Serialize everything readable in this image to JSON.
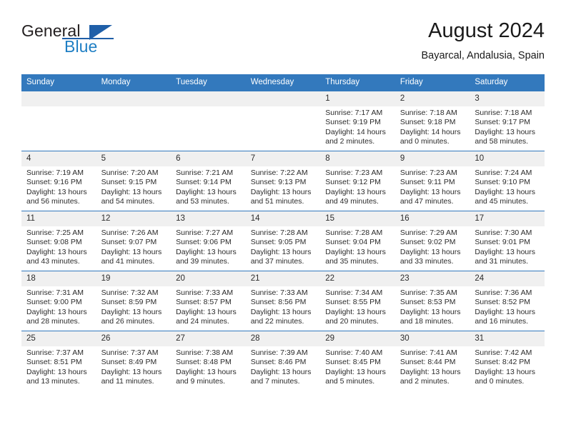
{
  "brand": {
    "name_part1": "General",
    "name_part2": "Blue",
    "logo_icon": "blue-triangle-icon"
  },
  "header": {
    "title": "August 2024",
    "location": "Bayarcal, Andalusia, Spain"
  },
  "calendar": {
    "weekday_headers": [
      "Sunday",
      "Monday",
      "Tuesday",
      "Wednesday",
      "Thursday",
      "Friday",
      "Saturday"
    ],
    "accent_color": "#3379bd",
    "daynum_bg": "#f0f0f0",
    "weeks": [
      [
        {
          "day": "",
          "empty": true
        },
        {
          "day": "",
          "empty": true
        },
        {
          "day": "",
          "empty": true
        },
        {
          "day": "",
          "empty": true
        },
        {
          "day": "1",
          "sunrise": "Sunrise: 7:17 AM",
          "sunset": "Sunset: 9:19 PM",
          "daylight": "Daylight: 14 hours and 2 minutes."
        },
        {
          "day": "2",
          "sunrise": "Sunrise: 7:18 AM",
          "sunset": "Sunset: 9:18 PM",
          "daylight": "Daylight: 14 hours and 0 minutes."
        },
        {
          "day": "3",
          "sunrise": "Sunrise: 7:18 AM",
          "sunset": "Sunset: 9:17 PM",
          "daylight": "Daylight: 13 hours and 58 minutes."
        }
      ],
      [
        {
          "day": "4",
          "sunrise": "Sunrise: 7:19 AM",
          "sunset": "Sunset: 9:16 PM",
          "daylight": "Daylight: 13 hours and 56 minutes."
        },
        {
          "day": "5",
          "sunrise": "Sunrise: 7:20 AM",
          "sunset": "Sunset: 9:15 PM",
          "daylight": "Daylight: 13 hours and 54 minutes."
        },
        {
          "day": "6",
          "sunrise": "Sunrise: 7:21 AM",
          "sunset": "Sunset: 9:14 PM",
          "daylight": "Daylight: 13 hours and 53 minutes."
        },
        {
          "day": "7",
          "sunrise": "Sunrise: 7:22 AM",
          "sunset": "Sunset: 9:13 PM",
          "daylight": "Daylight: 13 hours and 51 minutes."
        },
        {
          "day": "8",
          "sunrise": "Sunrise: 7:23 AM",
          "sunset": "Sunset: 9:12 PM",
          "daylight": "Daylight: 13 hours and 49 minutes."
        },
        {
          "day": "9",
          "sunrise": "Sunrise: 7:23 AM",
          "sunset": "Sunset: 9:11 PM",
          "daylight": "Daylight: 13 hours and 47 minutes."
        },
        {
          "day": "10",
          "sunrise": "Sunrise: 7:24 AM",
          "sunset": "Sunset: 9:10 PM",
          "daylight": "Daylight: 13 hours and 45 minutes."
        }
      ],
      [
        {
          "day": "11",
          "sunrise": "Sunrise: 7:25 AM",
          "sunset": "Sunset: 9:08 PM",
          "daylight": "Daylight: 13 hours and 43 minutes."
        },
        {
          "day": "12",
          "sunrise": "Sunrise: 7:26 AM",
          "sunset": "Sunset: 9:07 PM",
          "daylight": "Daylight: 13 hours and 41 minutes."
        },
        {
          "day": "13",
          "sunrise": "Sunrise: 7:27 AM",
          "sunset": "Sunset: 9:06 PM",
          "daylight": "Daylight: 13 hours and 39 minutes."
        },
        {
          "day": "14",
          "sunrise": "Sunrise: 7:28 AM",
          "sunset": "Sunset: 9:05 PM",
          "daylight": "Daylight: 13 hours and 37 minutes."
        },
        {
          "day": "15",
          "sunrise": "Sunrise: 7:28 AM",
          "sunset": "Sunset: 9:04 PM",
          "daylight": "Daylight: 13 hours and 35 minutes."
        },
        {
          "day": "16",
          "sunrise": "Sunrise: 7:29 AM",
          "sunset": "Sunset: 9:02 PM",
          "daylight": "Daylight: 13 hours and 33 minutes."
        },
        {
          "day": "17",
          "sunrise": "Sunrise: 7:30 AM",
          "sunset": "Sunset: 9:01 PM",
          "daylight": "Daylight: 13 hours and 31 minutes."
        }
      ],
      [
        {
          "day": "18",
          "sunrise": "Sunrise: 7:31 AM",
          "sunset": "Sunset: 9:00 PM",
          "daylight": "Daylight: 13 hours and 28 minutes."
        },
        {
          "day": "19",
          "sunrise": "Sunrise: 7:32 AM",
          "sunset": "Sunset: 8:59 PM",
          "daylight": "Daylight: 13 hours and 26 minutes."
        },
        {
          "day": "20",
          "sunrise": "Sunrise: 7:33 AM",
          "sunset": "Sunset: 8:57 PM",
          "daylight": "Daylight: 13 hours and 24 minutes."
        },
        {
          "day": "21",
          "sunrise": "Sunrise: 7:33 AM",
          "sunset": "Sunset: 8:56 PM",
          "daylight": "Daylight: 13 hours and 22 minutes."
        },
        {
          "day": "22",
          "sunrise": "Sunrise: 7:34 AM",
          "sunset": "Sunset: 8:55 PM",
          "daylight": "Daylight: 13 hours and 20 minutes."
        },
        {
          "day": "23",
          "sunrise": "Sunrise: 7:35 AM",
          "sunset": "Sunset: 8:53 PM",
          "daylight": "Daylight: 13 hours and 18 minutes."
        },
        {
          "day": "24",
          "sunrise": "Sunrise: 7:36 AM",
          "sunset": "Sunset: 8:52 PM",
          "daylight": "Daylight: 13 hours and 16 minutes."
        }
      ],
      [
        {
          "day": "25",
          "sunrise": "Sunrise: 7:37 AM",
          "sunset": "Sunset: 8:51 PM",
          "daylight": "Daylight: 13 hours and 13 minutes."
        },
        {
          "day": "26",
          "sunrise": "Sunrise: 7:37 AM",
          "sunset": "Sunset: 8:49 PM",
          "daylight": "Daylight: 13 hours and 11 minutes."
        },
        {
          "day": "27",
          "sunrise": "Sunrise: 7:38 AM",
          "sunset": "Sunset: 8:48 PM",
          "daylight": "Daylight: 13 hours and 9 minutes."
        },
        {
          "day": "28",
          "sunrise": "Sunrise: 7:39 AM",
          "sunset": "Sunset: 8:46 PM",
          "daylight": "Daylight: 13 hours and 7 minutes."
        },
        {
          "day": "29",
          "sunrise": "Sunrise: 7:40 AM",
          "sunset": "Sunset: 8:45 PM",
          "daylight": "Daylight: 13 hours and 5 minutes."
        },
        {
          "day": "30",
          "sunrise": "Sunrise: 7:41 AM",
          "sunset": "Sunset: 8:44 PM",
          "daylight": "Daylight: 13 hours and 2 minutes."
        },
        {
          "day": "31",
          "sunrise": "Sunrise: 7:42 AM",
          "sunset": "Sunset: 8:42 PM",
          "daylight": "Daylight: 13 hours and 0 minutes."
        }
      ]
    ]
  }
}
